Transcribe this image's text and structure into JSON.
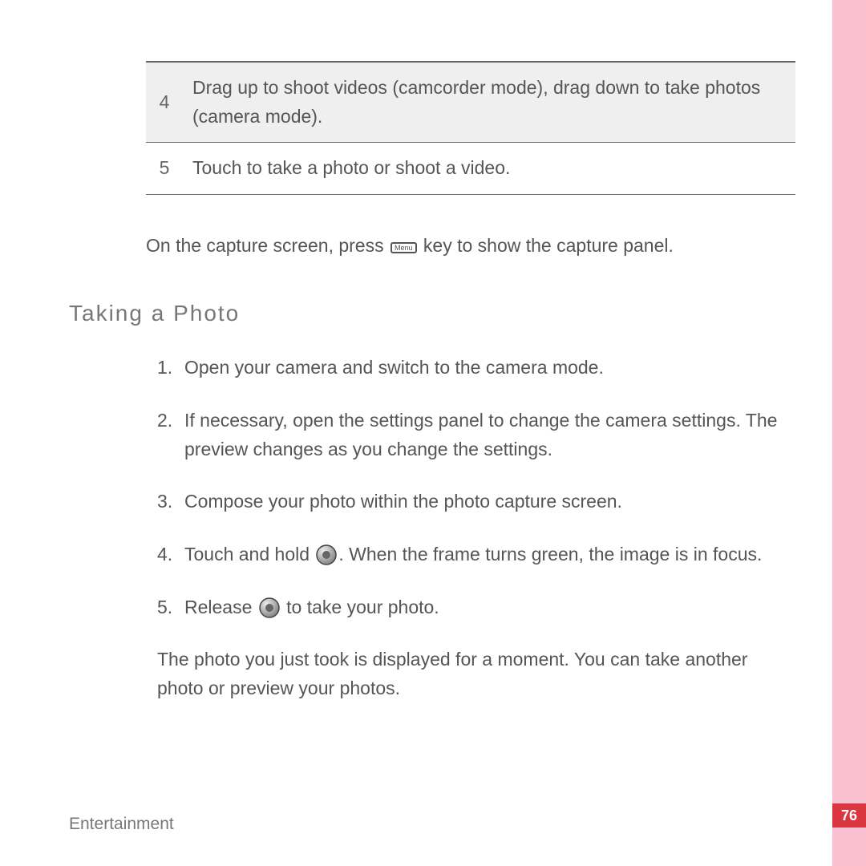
{
  "table": {
    "rows": [
      {
        "num": "4",
        "text": "Drag up to shoot videos (camcorder mode), drag down to take photos (camera mode)."
      },
      {
        "num": "5",
        "text": "Touch to take a photo or shoot a video."
      }
    ]
  },
  "capture_note": {
    "before": "On the capture screen, press",
    "key": "Menu",
    "after": "key to show the capture panel."
  },
  "section_title": "Taking  a  Photo",
  "steps": {
    "s1": "Open your camera and switch to the camera mode.",
    "s2": "If necessary, open the settings panel to change the camera settings. The preview changes as you change the settings.",
    "s3": "Compose your photo within the photo capture screen.",
    "s4_before": "Touch and hold ",
    "s4_after": ". When the frame turns green, the image is in focus.",
    "s5_before": "Release ",
    "s5_after": " to take your photo."
  },
  "closing": "The photo you just took is displayed for a moment. You can take another photo or preview your photos.",
  "footer": "Entertainment",
  "page_number": "76"
}
